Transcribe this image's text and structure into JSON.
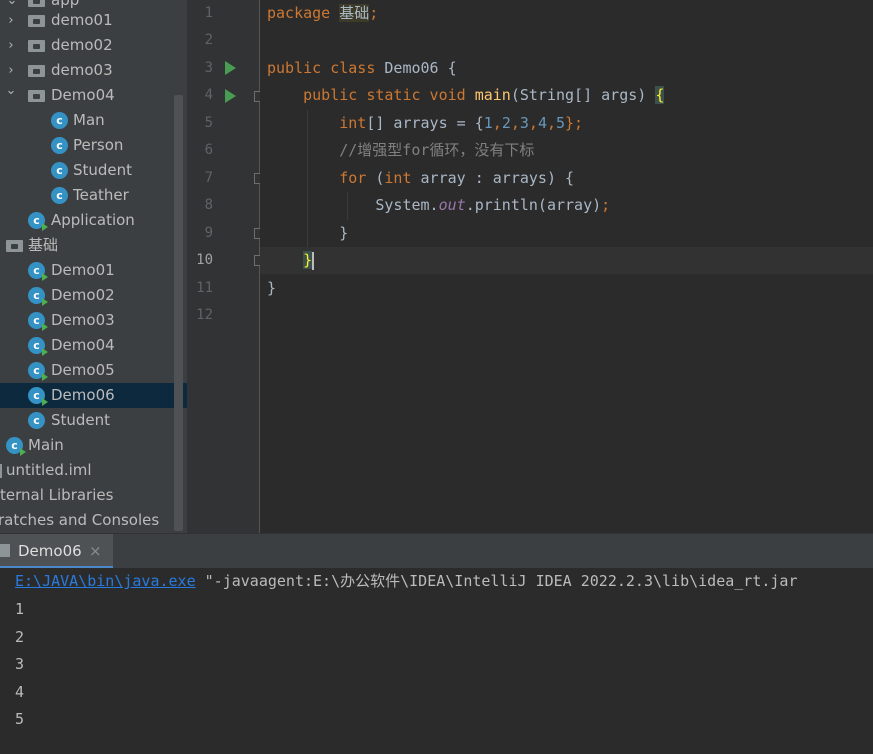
{
  "project_tree": {
    "items": [
      {
        "label": "app",
        "type": "folder",
        "indent": 0,
        "expanded": true
      },
      {
        "label": "demo01",
        "type": "folder",
        "indent": 1,
        "expanded": false
      },
      {
        "label": "demo02",
        "type": "folder",
        "indent": 1,
        "expanded": false
      },
      {
        "label": "demo03",
        "type": "folder",
        "indent": 1,
        "expanded": false
      },
      {
        "label": "Demo04",
        "type": "folder",
        "indent": 1,
        "expanded": true
      },
      {
        "label": "Man",
        "type": "class",
        "indent": 2
      },
      {
        "label": "Person",
        "type": "class",
        "indent": 2
      },
      {
        "label": "Student",
        "type": "class",
        "indent": 2
      },
      {
        "label": "Teather",
        "type": "class",
        "indent": 2
      },
      {
        "label": "Application",
        "type": "class-run",
        "indent": 1
      },
      {
        "label": "基础",
        "type": "folder",
        "indent": 0
      },
      {
        "label": "Demo01",
        "type": "class-run",
        "indent": 1
      },
      {
        "label": "Demo02",
        "type": "class-run",
        "indent": 1
      },
      {
        "label": "Demo03",
        "type": "class-run",
        "indent": 1
      },
      {
        "label": "Demo04",
        "type": "class-run",
        "indent": 1
      },
      {
        "label": "Demo05",
        "type": "class-run",
        "indent": 1
      },
      {
        "label": "Demo06",
        "type": "class-run",
        "indent": 1,
        "selected": true
      },
      {
        "label": "Student",
        "type": "class",
        "indent": 1
      },
      {
        "label": "Main",
        "type": "class-run",
        "indent": 0
      },
      {
        "label": "untitled.iml",
        "type": "file",
        "indent": 0
      },
      {
        "label": "ternal Libraries",
        "type": "library",
        "indent": 0
      },
      {
        "label": "ratches and Consoles",
        "type": "scratch",
        "indent": 0
      }
    ]
  },
  "editor": {
    "line_numbers": [
      "1",
      "2",
      "3",
      "4",
      "5",
      "6",
      "7",
      "8",
      "9",
      "10",
      "11",
      "12"
    ],
    "current_line": "10",
    "lines": {
      "l1_kw": "package",
      "l1_pkg": "基础",
      "l1_end": ";",
      "l3_kw": "public class",
      "l3_rest": " Demo06 {",
      "l4_kw": "public static void",
      "l4_fn": "main",
      "l4_rest": "(String[] args) ",
      "l4_brace": "{",
      "l5_kw": "int",
      "l5_a": "[] arrays = {",
      "l5_n1": "1",
      "l5_c1": ",",
      "l5_n2": "2",
      "l5_c2": ",",
      "l5_n3": "3",
      "l5_c3": ",",
      "l5_n4": "4",
      "l5_c4": ",",
      "l5_n5": "5",
      "l5_end": "};",
      "l6_comment": "//增强型for循环，没有下标",
      "l7_kw": "for",
      "l7_a": " (",
      "l7_kw2": "int",
      "l7_b": " array : arrays) {",
      "l8_a": "System.",
      "l8_static": "out",
      "l8_b": ".println(array)",
      "l8_end": ";",
      "l9": "}",
      "l10": "}",
      "l11": "}"
    }
  },
  "run_window": {
    "tab_label": "Demo06",
    "close_glyph": "×",
    "command_link": "E:\\JAVA\\bin\\java.exe",
    "command_rest": " \"-javaagent:E:\\办公软件\\IDEA\\IntelliJ IDEA 2022.2.3\\lib\\idea_rt.jar",
    "output": [
      "1",
      "2",
      "3",
      "4",
      "5"
    ]
  },
  "colors": {
    "keyword": "#cc7832",
    "function": "#ffc66d",
    "number": "#6897bb",
    "comment": "#808080",
    "static_field": "#9876aa",
    "link": "#287bde",
    "run_icon": "#499c54",
    "selection": "#0d293e"
  }
}
